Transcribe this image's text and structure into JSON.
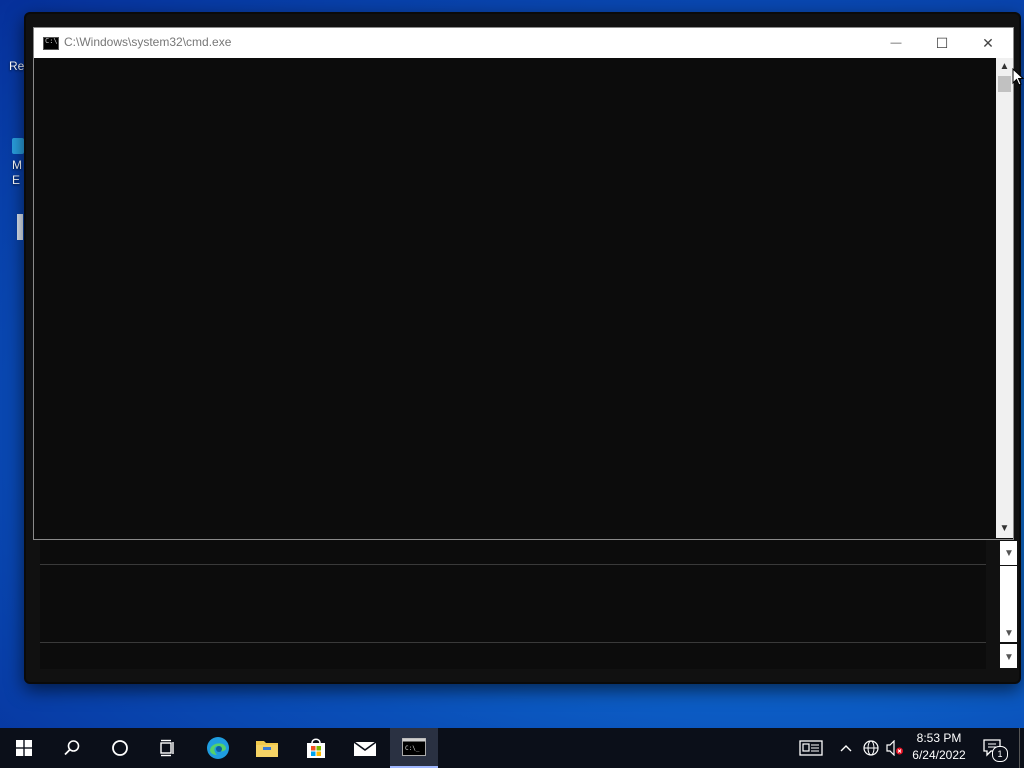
{
  "desktop": {
    "icon_labels": [
      "Re",
      "M",
      "E"
    ]
  },
  "window": {
    "title": "C:\\Windows\\system32\\cmd.exe",
    "minimize_glyph": "—",
    "maximize_glyph": "☐",
    "close_glyph": "✕",
    "scroll_up_glyph": "▲",
    "scroll_down_glyph": "▼"
  },
  "taskbar": {
    "items": [
      {
        "name": "start",
        "icon": "windows-logo-icon"
      },
      {
        "name": "search",
        "icon": "search-icon"
      },
      {
        "name": "cortana",
        "icon": "circle-icon"
      },
      {
        "name": "task-view",
        "icon": "task-view-icon"
      },
      {
        "name": "edge",
        "icon": "edge-icon"
      },
      {
        "name": "file-explorer",
        "icon": "folder-icon"
      },
      {
        "name": "store",
        "icon": "store-icon"
      },
      {
        "name": "mail",
        "icon": "mail-icon"
      },
      {
        "name": "cmd",
        "icon": "cmd-icon",
        "active": true
      }
    ],
    "tray": {
      "news_icon": "news-icon",
      "chevron_glyph": "^",
      "network_icon": "globe-icon",
      "volume_icon": "muted-volume-icon",
      "time": "8:53 PM",
      "date": "6/24/2022",
      "notification_count": "1"
    }
  },
  "colors": {
    "console_bg": "#0c0c0c",
    "taskbar_bg": "#0b0f19",
    "desktop_blue": "#0f6fd6"
  }
}
